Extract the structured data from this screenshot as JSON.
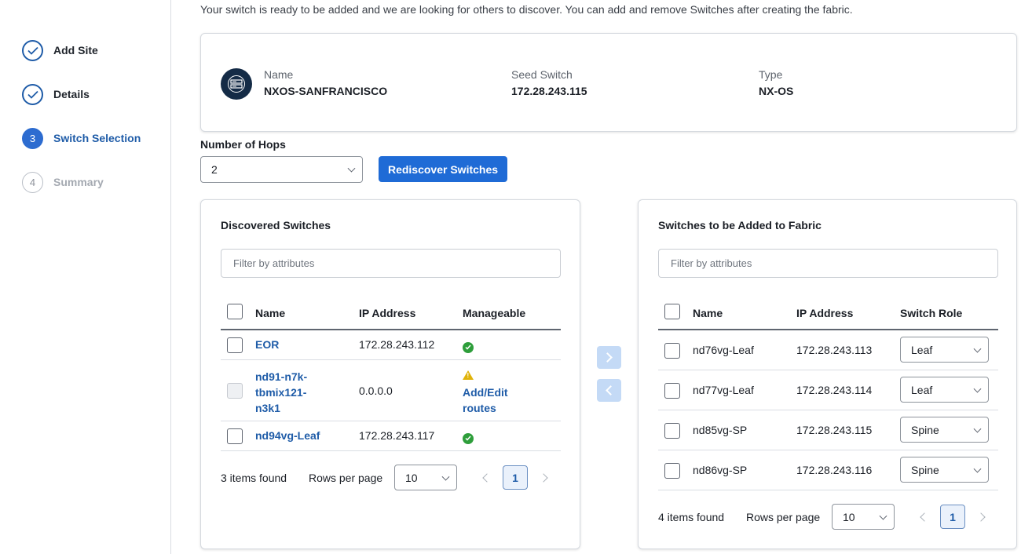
{
  "wizard": {
    "steps": [
      {
        "label": "Add Site",
        "number": "1",
        "state": "done"
      },
      {
        "label": "Details",
        "number": "2",
        "state": "done"
      },
      {
        "label": "Switch Selection",
        "number": "3",
        "state": "active"
      },
      {
        "label": "Summary",
        "number": "4",
        "state": "pending"
      }
    ]
  },
  "intro_text": "Your switch is ready to be added and we are looking for others to discover. You can add and remove Switches after creating the fabric.",
  "fabric": {
    "icon": "server-rack-icon",
    "name_label": "Name",
    "name_value": "NXOS-SANFRANCISCO",
    "seed_label": "Seed Switch",
    "seed_value": "172.28.243.115",
    "type_label": "Type",
    "type_value": "NX-OS"
  },
  "hops": {
    "label": "Number of Hops",
    "value": "2",
    "rediscover_label": "Rediscover Switches"
  },
  "discovered": {
    "title": "Discovered Switches",
    "filter_placeholder": "Filter by attributes",
    "columns": [
      "Name",
      "IP Address",
      "Manageable"
    ],
    "rows": [
      {
        "name": "EOR",
        "ip": "172.28.243.112",
        "manageable": "ok"
      },
      {
        "name_lines": [
          "nd91-n7k-",
          "tbmix121-",
          "n3k1"
        ],
        "ip": "0.0.0.0",
        "manageable": "warning",
        "action_lines": [
          "Add/Edit",
          "routes"
        ]
      },
      {
        "name": "nd94vg-Leaf",
        "ip": "172.28.243.117",
        "manageable": "ok"
      }
    ],
    "count_text": "3 items found",
    "rows_per_page_label": "Rows per page",
    "rows_per_page": "10",
    "page": "1"
  },
  "to_add": {
    "title": "Switches to be Added to Fabric",
    "filter_placeholder": "Filter by attributes",
    "columns": [
      "Name",
      "IP Address",
      "Switch Role"
    ],
    "rows": [
      {
        "name": "nd76vg-Leaf",
        "ip": "172.28.243.113",
        "role": "Leaf"
      },
      {
        "name": "nd77vg-Leaf",
        "ip": "172.28.243.114",
        "role": "Leaf"
      },
      {
        "name": "nd85vg-SP",
        "ip": "172.28.243.115",
        "role": "Spine"
      },
      {
        "name": "nd86vg-SP",
        "ip": "172.28.243.116",
        "role": "Spine"
      }
    ],
    "count_text": "4 items found",
    "rows_per_page_label": "Rows per page",
    "rows_per_page": "10",
    "page": "1"
  },
  "colors": {
    "accent": "#1f6bd6",
    "link": "#1f5ca8",
    "success": "#2e9e3b",
    "warning": "#e0b30a"
  }
}
